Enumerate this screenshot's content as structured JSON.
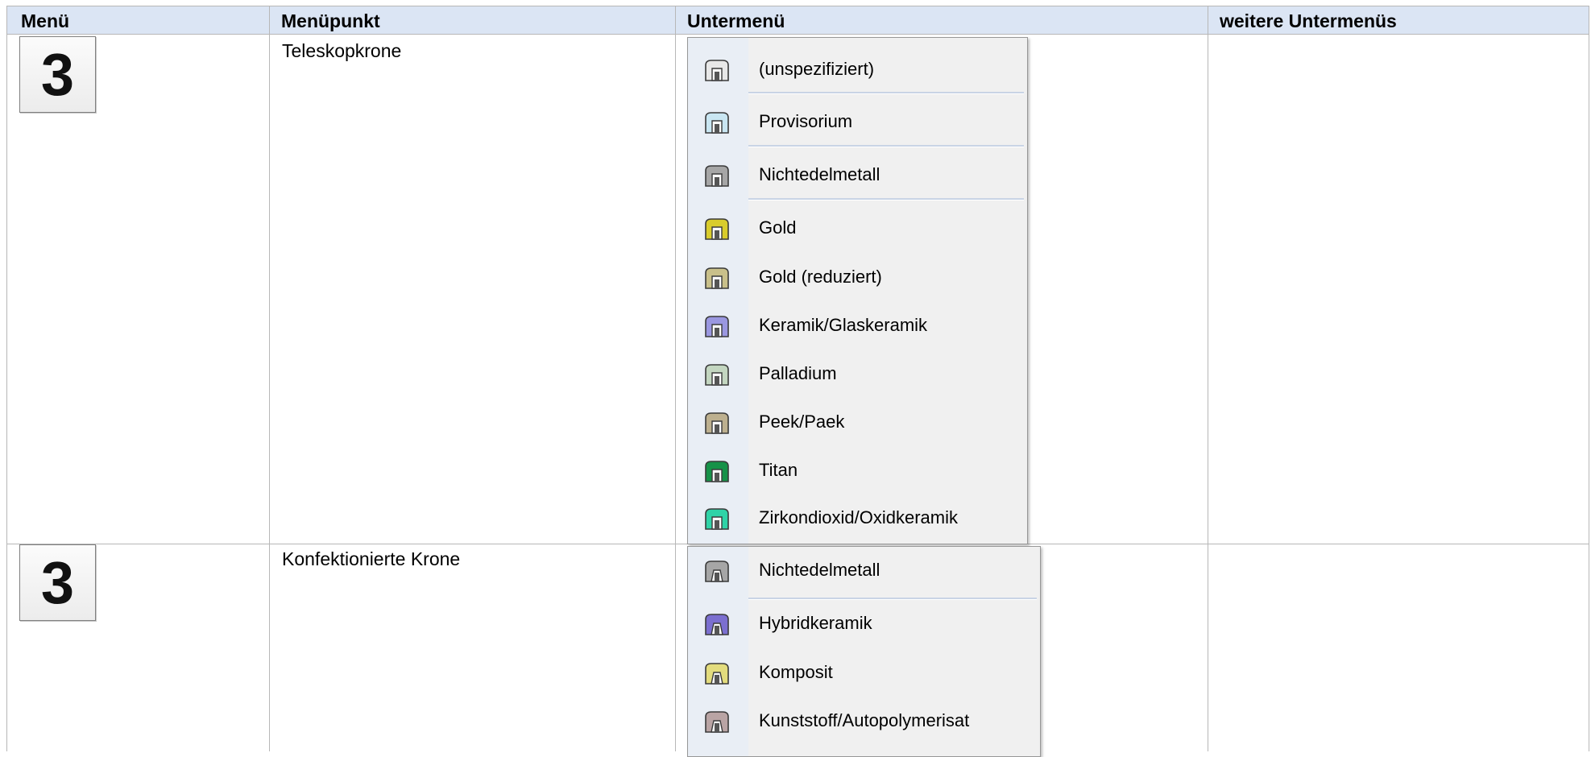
{
  "table": {
    "headers": {
      "menu": "Menü",
      "item": "Menüpunkt",
      "submenu": "Untermenü",
      "more": "weitere Untermenüs"
    },
    "rows": [
      {
        "menu_key": "3",
        "item": "Teleskopkrone",
        "submenu": [
          {
            "label": "(unspezifiziert)",
            "icon": "crown-unspecified-icon",
            "color": "#e8e8e8"
          },
          {
            "label": "Provisorium",
            "icon": "crown-provisional-icon",
            "color": "#c9e6f2"
          },
          {
            "label": "Nichtedelmetall",
            "icon": "crown-base-metal-icon",
            "color": "#a6a6a6"
          },
          {
            "label": "Gold",
            "icon": "crown-gold-icon",
            "color": "#d9cc2b"
          },
          {
            "label": "Gold (reduziert)",
            "icon": "crown-gold-reduced-icon",
            "color": "#c9c08a"
          },
          {
            "label": "Keramik/Glaskeramik",
            "icon": "crown-ceramic-icon",
            "color": "#9a97e0"
          },
          {
            "label": "Palladium",
            "icon": "crown-palladium-icon",
            "color": "#c3d6c0"
          },
          {
            "label": "Peek/Paek",
            "icon": "crown-peek-icon",
            "color": "#bdb08f"
          },
          {
            "label": "Titan",
            "icon": "crown-titanium-icon",
            "color": "#169248"
          },
          {
            "label": "Zirkondioxid/Oxidkeramik",
            "icon": "crown-zirconia-icon",
            "color": "#2fd3a7"
          }
        ]
      },
      {
        "menu_key": "3",
        "item": "Konfektionierte Krone",
        "submenu": [
          {
            "label": "Nichtedelmetall",
            "icon": "prefab-crown-base-metal-icon",
            "color": "#a6a6a6"
          },
          {
            "label": "Hybridkeramik",
            "icon": "prefab-crown-hybrid-ceramic-icon",
            "color": "#7b6fd0"
          },
          {
            "label": "Komposit",
            "icon": "prefab-crown-composite-icon",
            "color": "#e3dc7d"
          },
          {
            "label": "Kunststoff/Autopolymerisat",
            "icon": "prefab-crown-resin-icon",
            "color": "#b9a4a4"
          }
        ]
      }
    ]
  }
}
